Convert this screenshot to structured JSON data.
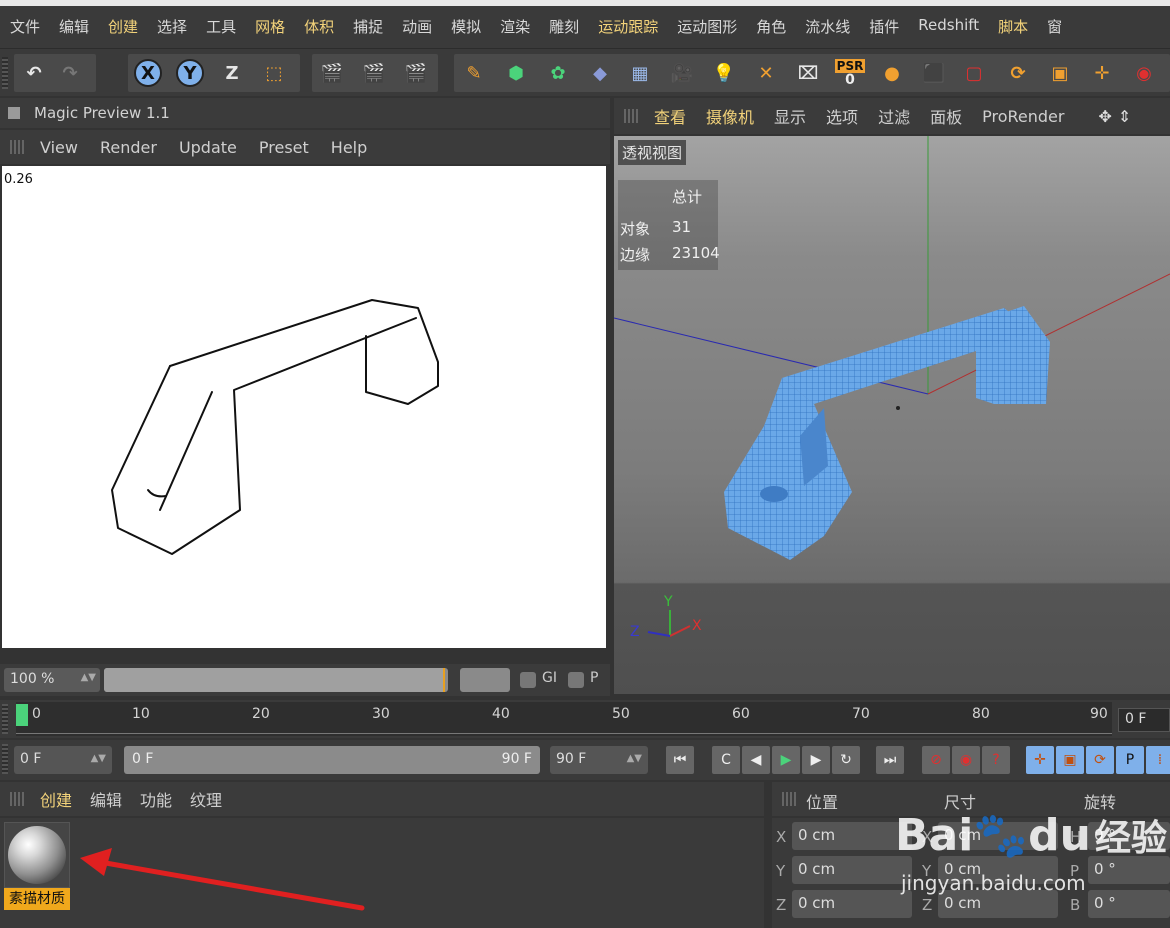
{
  "menubar": {
    "items": [
      "文件",
      "编辑",
      "创建",
      "选择",
      "工具",
      "网格",
      "体积",
      "捕捉",
      "动画",
      "模拟",
      "渲染",
      "雕刻",
      "运动跟踪",
      "运动图形",
      "角色",
      "流水线",
      "插件",
      "Redshift",
      "脚本",
      "窗"
    ]
  },
  "toolbar": {
    "axis_x": "X",
    "axis_y": "Y",
    "axis_z": "Z",
    "psr_label": "PSR",
    "psr_value": "0"
  },
  "magic_preview": {
    "title": "Magic Preview 1.1",
    "menu": [
      "View",
      "Render",
      "Update",
      "Preset",
      "Help"
    ],
    "value_readout": "0.26",
    "zoom": "100 %",
    "progress": 0.99,
    "gi_label": "GI",
    "p_label": "P"
  },
  "viewport": {
    "menu": [
      "查看",
      "摄像机",
      "显示",
      "选项",
      "过滤",
      "面板",
      "ProRender"
    ],
    "view_name": "透视视图",
    "stats": {
      "header": "总计",
      "rows": [
        {
          "label": "对象",
          "value": "31"
        },
        {
          "label": "边缘",
          "value": "23104"
        }
      ]
    },
    "axis_gizmo": {
      "y": "Y",
      "z": "Z",
      "x": "X"
    }
  },
  "timeline": {
    "ticks": [
      "0",
      "10",
      "20",
      "30",
      "40",
      "50",
      "60",
      "70",
      "80",
      "90"
    ],
    "current_frame": "0 F"
  },
  "transport": {
    "start_field": "0 F",
    "range_start": "0 F",
    "range_end": "90 F",
    "end_field": "90 F"
  },
  "material_manager": {
    "menu": [
      "创建",
      "编辑",
      "功能",
      "纹理"
    ],
    "material_name": "素描材质"
  },
  "attributes": {
    "headers": [
      "位置",
      "尺寸",
      "旋转"
    ],
    "rows": [
      {
        "label": "X",
        "pos": "0 cm",
        "size": "0 cm",
        "rot_label": "H",
        "rot": "0 °"
      },
      {
        "label": "Y",
        "pos": "0 cm",
        "size": "0 cm",
        "rot_label": "P",
        "rot": "0 °"
      },
      {
        "label": "Z",
        "pos": "0 cm",
        "size": "0 cm",
        "rot_label": "B",
        "rot": "0 °"
      }
    ]
  },
  "watermark": {
    "brand": "Bai",
    "brand2": "du",
    "cn": "经验",
    "url": "jingyan.baidu.com"
  },
  "colors": {
    "accent": "#f2d27a",
    "mesh": "#5aa0e6",
    "material_label": "#f0a81c",
    "frame_marker": "#4bd37b",
    "arrow": "#e02020"
  }
}
